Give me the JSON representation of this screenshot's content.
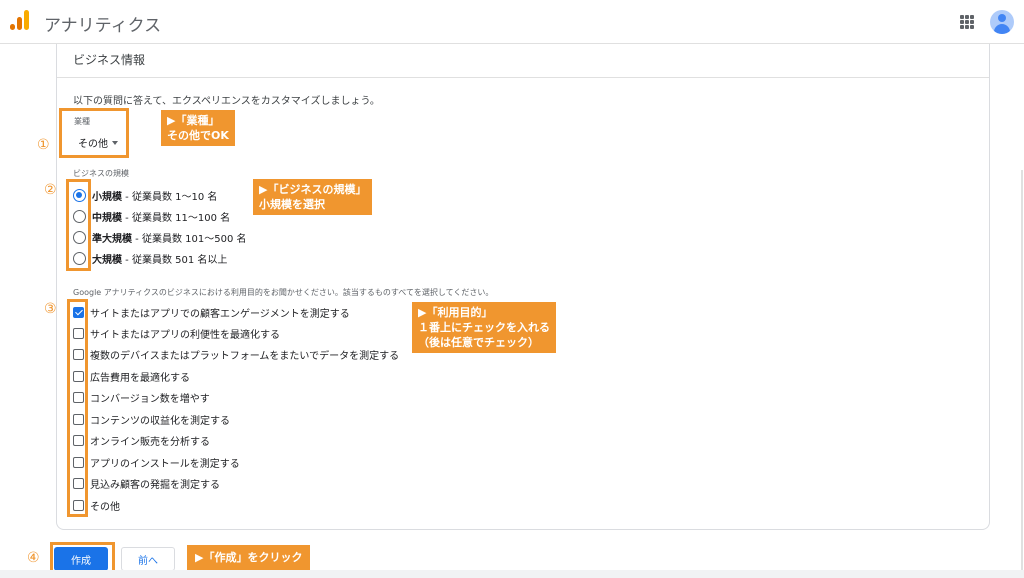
{
  "header": {
    "app_title": "アナリティクス",
    "apps_icon": "grid-apps-icon",
    "avatar_icon": "account-avatar-icon",
    "logo_icon": "analytics-logo-icon"
  },
  "card": {
    "title": "ビジネス情報",
    "intro": "以下の質問に答えて、エクスペリエンスをカスタマイズしましょう。",
    "industry": {
      "label": "業種",
      "selected": "その他"
    },
    "size": {
      "label": "ビジネスの規模",
      "options": [
        {
          "bold": "小規模",
          "rest": " - 従業員数 1〜10 名",
          "selected": true
        },
        {
          "bold": "中規模",
          "rest": " - 従業員数 11〜100 名",
          "selected": false
        },
        {
          "bold": "準大規模",
          "rest": " - 従業員数 101〜500 名",
          "selected": false
        },
        {
          "bold": "大規模",
          "rest": " - 従業員数 501 名以上",
          "selected": false
        }
      ]
    },
    "purpose": {
      "label": "Google アナリティクスのビジネスにおける利用目的をお聞かせください。該当するものすべてを選択してください。",
      "options": [
        {
          "text": "サイトまたはアプリでの顧客エンゲージメントを測定する",
          "checked": true
        },
        {
          "text": "サイトまたはアプリの利便性を最適化する",
          "checked": false
        },
        {
          "text": "複数のデバイスまたはプラットフォームをまたいでデータを測定する",
          "checked": false
        },
        {
          "text": "広告費用を最適化する",
          "checked": false
        },
        {
          "text": "コンバージョン数を増やす",
          "checked": false
        },
        {
          "text": "コンテンツの収益化を測定する",
          "checked": false
        },
        {
          "text": "オンライン販売を分析する",
          "checked": false
        },
        {
          "text": "アプリのインストールを測定する",
          "checked": false
        },
        {
          "text": "見込み顧客の発掘を測定する",
          "checked": false
        },
        {
          "text": "その他",
          "checked": false
        }
      ]
    }
  },
  "buttons": {
    "create": "作成",
    "back": "前へ"
  },
  "annotations": {
    "markers": [
      "①",
      "②",
      "③",
      "④"
    ],
    "note1": [
      "▶「業種」",
      "その他でOK"
    ],
    "note2": [
      "▶「ビジネスの規模」",
      "小規模を選択"
    ],
    "note3": [
      "▶「利用目的」",
      "１番上にチェックを入れる",
      "（後は任意でチェック）"
    ],
    "note4": [
      "▶「作成」をクリック"
    ],
    "accent_color": "#f0962f"
  },
  "colors": {
    "primary": "#1a73e8"
  }
}
